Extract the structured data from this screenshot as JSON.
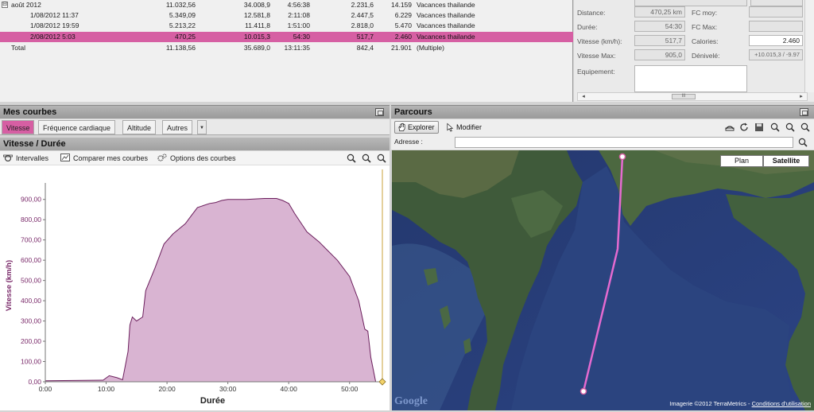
{
  "activities": {
    "rows": [
      {
        "name": "août 2012",
        "distance": "11.032,56",
        "col2": "34.008,9",
        "duration": "4:56:38",
        "col4": "2.231,6",
        "col5": "14.159",
        "category": "Vacances thailande",
        "group": true
      },
      {
        "name": "1/08/2012 11:37",
        "distance": "5.349,09",
        "col2": "12.581,8",
        "duration": "2:11:08",
        "col4": "2.447,5",
        "col5": "6.229",
        "category": "Vacances thailande"
      },
      {
        "name": "1/08/2012 19:59",
        "distance": "5.213,22",
        "col2": "11.411,8",
        "duration": "1:51:00",
        "col4": "2.818,0",
        "col5": "5.470",
        "category": "Vacances thailande"
      },
      {
        "name": "2/08/2012 5:03",
        "distance": "470,25",
        "col2": "10.015,3",
        "duration": "54:30",
        "col4": "517,7",
        "col5": "2.460",
        "category": "Vacances thailande",
        "selected": true
      },
      {
        "name": "Total",
        "distance": "11.138,56",
        "col2": "35.689,0",
        "duration": "13:11:35",
        "col4": "842,4",
        "col5": "21.901",
        "category": "(Multiple)"
      }
    ],
    "expander": "⊟"
  },
  "stats": {
    "distance_label": "Distance:",
    "distance_value": "470,25 km",
    "fcmoy_label": "FC moy:",
    "fcmoy_value": "",
    "duree_label": "Durée:",
    "duree_value": "54:30",
    "fcmax_label": "FC Max:",
    "fcmax_value": "",
    "vitesse_label": "Vitesse (km/h):",
    "vitesse_value": "517,7",
    "calories_label": "Calories:",
    "calories_value": "2.460",
    "vitmax_label": "Vitesse Max:",
    "vitmax_value": "905,0",
    "denivele_label": "Dénivelé:",
    "denivele_value": "+10.015,3 / -9.97",
    "equipement_label": "Equipement:",
    "hscroll_left": "◂",
    "hscroll_right": "▸",
    "hscroll_thumb": "III"
  },
  "courbes": {
    "title": "Mes courbes",
    "tabs": [
      "Vitesse",
      "Fréquence cardiaque",
      "Altitude",
      "Autres"
    ],
    "tab_dropdown": "▼",
    "chart_title": "Vitesse / Durée",
    "toolbar": {
      "intervalles": "Intervalles",
      "comparer": "Comparer mes courbes",
      "options": "Options des courbes"
    }
  },
  "parcours": {
    "title": "Parcours",
    "explorer_label": "Explorer",
    "modifier_label": "Modifier",
    "address_label": "Adresse :",
    "address_value": "",
    "map_types": [
      "Plan",
      "Satellite"
    ],
    "copyright": "Imagerie ©2012 TerraMetrics -",
    "terms": "Conditions d'utilisation",
    "logo": "Google"
  },
  "colors": {
    "accent": "#d65fa3",
    "curve": "#6b1e5c",
    "fill": "#d9b4d2",
    "axis_text": "#7a2a6a",
    "route": "#e56ad0"
  },
  "chart_data": {
    "type": "area",
    "xlabel": "Durée",
    "ylabel": "Vitesse (km/h)",
    "xlim": [
      0,
      55
    ],
    "ylim": [
      0,
      950
    ],
    "xticks": [
      "0:00",
      "10:00",
      "20:00",
      "30:00",
      "40:00",
      "50:00"
    ],
    "yticks": [
      "0,00",
      "100,00",
      "200,00",
      "300,00",
      "400,00",
      "500,00",
      "600,00",
      "700,00",
      "800,00",
      "900,00"
    ],
    "grid": false,
    "series": [
      {
        "x": [
          0,
          9.5,
          10.5,
          11.8,
          12.7,
          13.6,
          13.9,
          14.3,
          15,
          16,
          16.5,
          18,
          19.5,
          21,
          23,
          24,
          25,
          26,
          27,
          28,
          29,
          30,
          33,
          36,
          38,
          39,
          40,
          41,
          43,
          45,
          46,
          48,
          50,
          51.5,
          52.5,
          53,
          53.5,
          54.3
        ],
        "y": [
          5,
          8,
          30,
          20,
          10,
          150,
          280,
          320,
          300,
          320,
          450,
          560,
          680,
          730,
          780,
          820,
          860,
          870,
          880,
          885,
          895,
          900,
          900,
          905,
          905,
          895,
          880,
          830,
          740,
          690,
          660,
          600,
          520,
          400,
          260,
          250,
          120,
          0
        ]
      }
    ]
  }
}
